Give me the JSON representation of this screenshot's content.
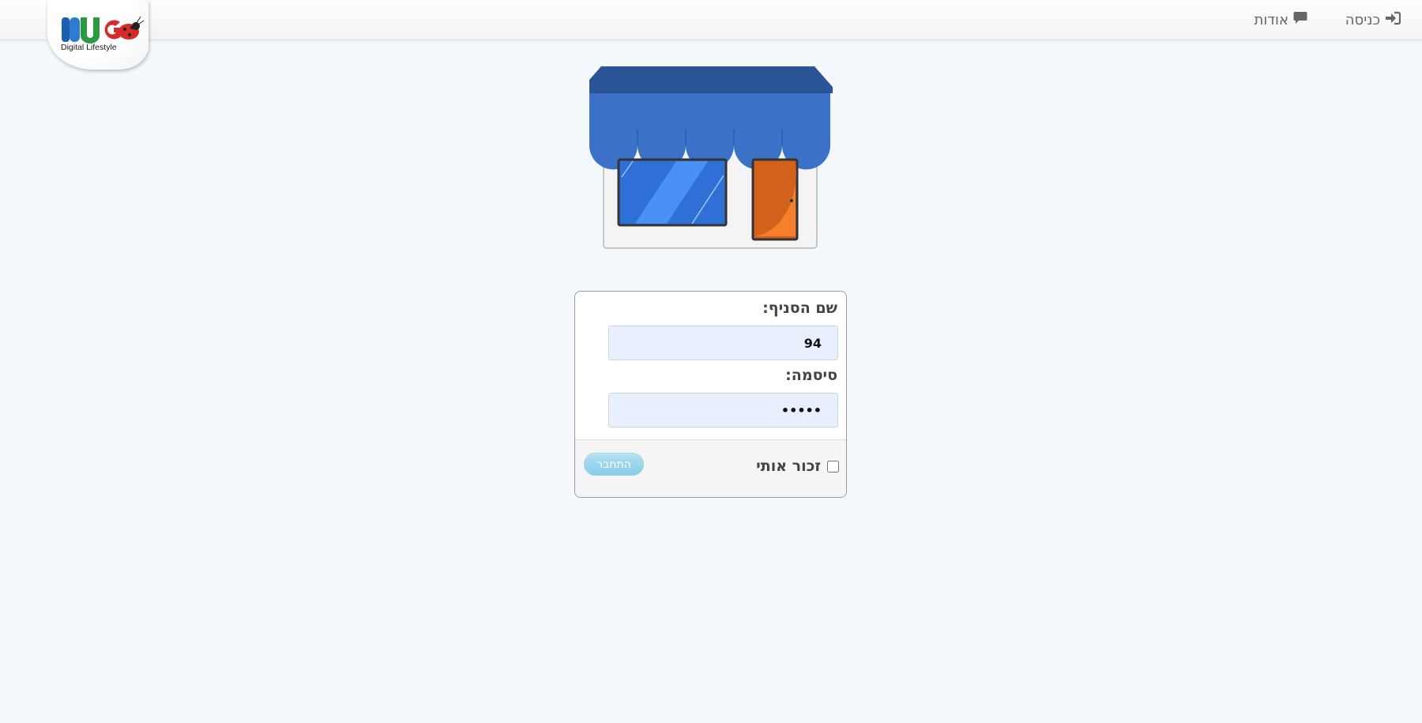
{
  "nav": {
    "login_label": "כניסה",
    "login_icon": "sign-in-icon",
    "about_label": "אודות",
    "about_icon": "comment-icon"
  },
  "logo": {
    "brand_text": "BUG",
    "tagline": "Digital Lifestyle"
  },
  "form": {
    "branch_label": "שם הסניף:",
    "branch_value": "94",
    "password_label": "סיסמה:",
    "password_value": "•••••",
    "remember_label": "זכור אותי",
    "remember_checked": false,
    "submit_label": "התחבר"
  },
  "colors": {
    "page_background": "#f2f8fc",
    "awning": "#3b72c8",
    "submit_button": "#7ec8e6"
  }
}
